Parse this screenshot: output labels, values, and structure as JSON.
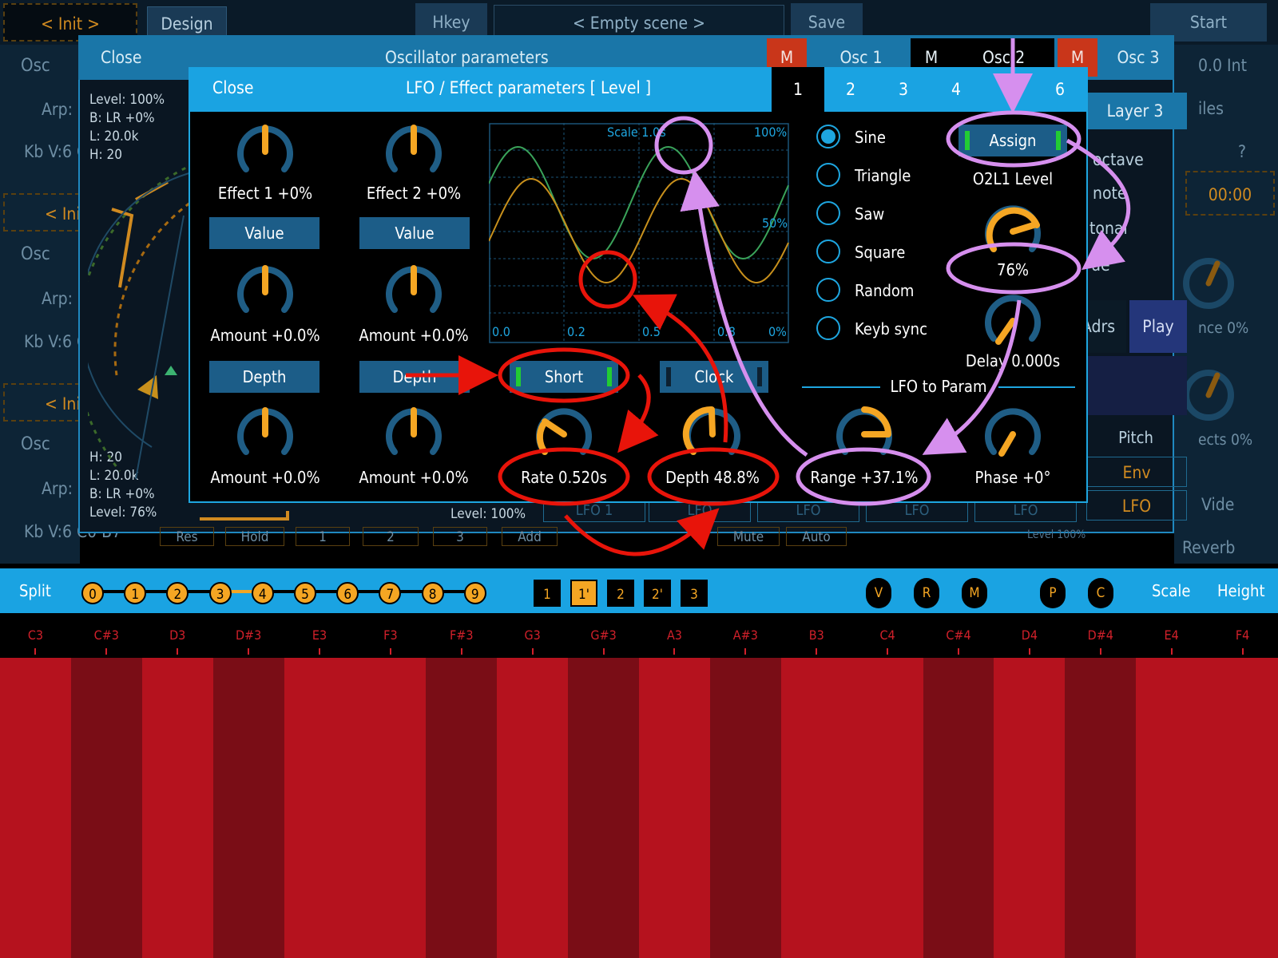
{
  "topbar": {
    "init": "< Init >",
    "design": "Design",
    "hkey": "Hkey",
    "scene": "< Empty scene >",
    "save": "Save",
    "start": "Start"
  },
  "left": {
    "osc": "Osc",
    "arp": "Arp:",
    "kb": "Kb V:6 C",
    "kb3": "Kb V:6 C0 B7",
    "ini": "< Ini",
    "ini3": "< Ini"
  },
  "right": {
    "int": "0.0 Int",
    "files": "iles",
    "q": "?",
    "time": "00:00",
    "octave": "octave",
    "note": "note",
    "tonal": "tonal",
    "ue": "ue",
    "adrs": "Adrs",
    "play": "Play",
    "nce": "nce 0%",
    "ects": "ects 0%",
    "pitch": "Pitch",
    "env": "Env",
    "lfo": "LFO",
    "vide": "Vide",
    "reverb": "Reverb",
    "layer3": "Layer 3"
  },
  "osc_panel": {
    "close": "Close",
    "title": "Oscillator parameters",
    "m": "M",
    "osc1": "Osc 1",
    "osc2": "Osc 2",
    "osc3": "Osc 3",
    "info_top": [
      "Level: 100%",
      "B: LR +0%",
      "L: 20.0k",
      "H: 20"
    ],
    "info_bottom": [
      "H: 20",
      "L: 20.0k",
      "B: LR +0%",
      "Level: 76%"
    ],
    "level": "Level: 100%",
    "lfo_tabs": [
      "LFO 1",
      "LFO",
      "LFO",
      "LFO",
      "LFO"
    ],
    "bottom_btns": [
      "Res",
      "Hold",
      "1",
      "2",
      "3",
      "Add",
      "Mute",
      "Auto"
    ],
    "level_right": "Level 100%"
  },
  "lfo_panel": {
    "close": "Close",
    "title": "LFO / Effect parameters [ Level ]",
    "tabs": [
      "1",
      "2",
      "3",
      "4",
      "5",
      "6"
    ],
    "effect1": "Effect 1 +0%",
    "effect2": "Effect 2 +0%",
    "value": "Value",
    "amount": "Amount +0.0%",
    "depth": "Depth",
    "plot": {
      "scale": "Scale 1.0s",
      "pct100": "100%",
      "pct50": "50%",
      "pct0": "0%",
      "xticks": [
        "0.0",
        "0.2",
        "0.5",
        "0.8"
      ]
    },
    "short": "Short",
    "clock": "Clock",
    "rate": "Rate 0.520s",
    "depth_val": "Depth 48.8%",
    "waves": [
      "Sine",
      "Triangle",
      "Saw",
      "Square",
      "Random",
      "Keyb sync"
    ],
    "wave_selected": "Sine",
    "assign": "Assign",
    "target": "O2L1 Level",
    "pct76": "76%",
    "delay": "Delay 0.000s",
    "lfo_to_param": "LFO to Param",
    "range": "Range +37.1%",
    "phase": "Phase +0°"
  },
  "keybar": {
    "split": "Split",
    "nums": [
      "0",
      "1",
      "2",
      "3",
      "4",
      "5",
      "6",
      "7",
      "8",
      "9"
    ],
    "highlight": [
      "3",
      "4"
    ],
    "boxes": [
      "1",
      "1'",
      "2",
      "2'",
      "3"
    ],
    "box_active": "1'",
    "letters": [
      "V",
      "R",
      "M",
      "P",
      "C"
    ],
    "scale": "Scale",
    "height": "Height"
  },
  "keys": [
    "C3",
    "C#3",
    "D3",
    "D#3",
    "E3",
    "F3",
    "F#3",
    "G3",
    "G#3",
    "A3",
    "A#3",
    "B3",
    "C4",
    "C#4",
    "D4",
    "D#4",
    "E4",
    "F4"
  ],
  "colors": {
    "accent": "#1ea6e0",
    "orange": "#f5a623",
    "key_white": "#b5121e",
    "key_black": "#7a0d16",
    "red": "#e8140a",
    "purple": "#d68fee"
  }
}
